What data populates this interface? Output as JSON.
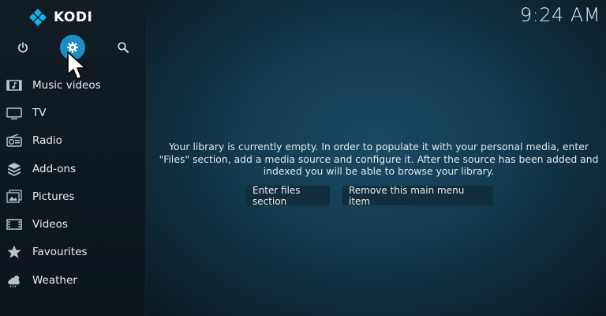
{
  "app": {
    "name": "KODI",
    "clock": "9:24 AM"
  },
  "top_icons": [
    {
      "name": "power-icon"
    },
    {
      "name": "settings-icon"
    },
    {
      "name": "search-icon"
    }
  ],
  "menu": {
    "items": [
      {
        "label": "Music videos",
        "icon": "music-video-icon"
      },
      {
        "label": "TV",
        "icon": "tv-icon"
      },
      {
        "label": "Radio",
        "icon": "radio-icon"
      },
      {
        "label": "Add-ons",
        "icon": "addons-icon"
      },
      {
        "label": "Pictures",
        "icon": "pictures-icon"
      },
      {
        "label": "Videos",
        "icon": "videos-icon"
      },
      {
        "label": "Favourites",
        "icon": "star-icon"
      },
      {
        "label": "Weather",
        "icon": "weather-icon"
      }
    ]
  },
  "main": {
    "message": "Your library is currently empty. In order to populate it with your personal media, enter \"Files\" section, add a media source and configure it. After the source has been added and indexed you will be able to browse your library.",
    "buttons": {
      "enter": "Enter files section",
      "remove": "Remove this main menu item"
    }
  },
  "colors": {
    "accent": "#1c8ec3",
    "sidebar": "#0e1820",
    "button": "#122d3d"
  }
}
